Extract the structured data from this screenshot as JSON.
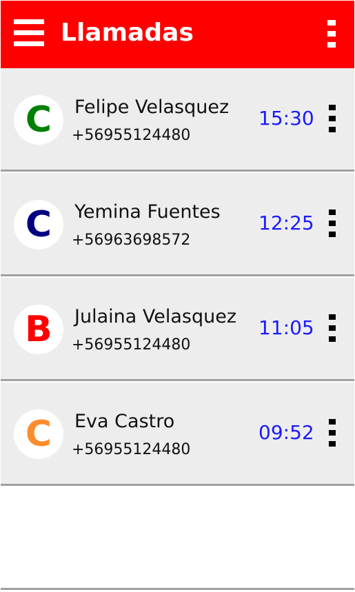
{
  "header": {
    "title": "Llamadas",
    "background_color": "#ff0000",
    "menu_icon": "hamburger-menu-icon",
    "overflow_icon": "more-vertical-icon"
  },
  "calls": [
    {
      "initial": "C",
      "initial_color": "#008000",
      "name": "Felipe Velasquez",
      "phone": "+56955124480",
      "time": "15:30"
    },
    {
      "initial": "C",
      "initial_color": "#000080",
      "name": "Yemina Fuentes",
      "phone": "+56963698572",
      "time": "12:25"
    },
    {
      "initial": "B",
      "initial_color": "#ff0000",
      "name": "Julaina Velasquez",
      "phone": "+56955124480",
      "time": "11:05"
    },
    {
      "initial": "C",
      "initial_color": "#ff8c2a",
      "name": "Eva Castro",
      "phone": "+56955124480",
      "time": "09:52"
    }
  ],
  "colors": {
    "time": "#1a1aff",
    "row_background": "#ededed",
    "divider": "#a0a0a0"
  }
}
